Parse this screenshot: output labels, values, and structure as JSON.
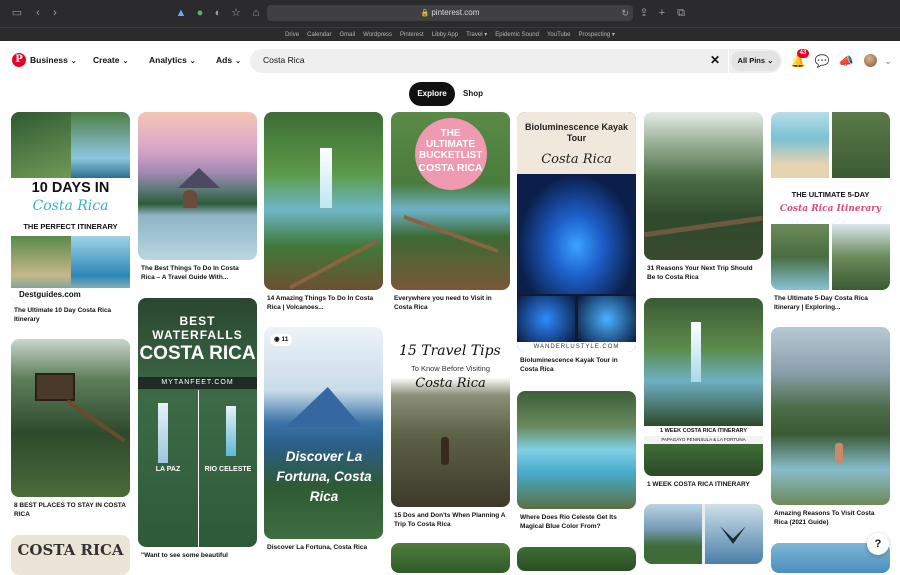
{
  "browser": {
    "url": "pinterest.com",
    "bookmarks": [
      "Drive",
      "Calendar",
      "Gmail",
      "Wordpress",
      "Pinterest",
      "Libby App",
      "Travel ▾",
      "Epidemic Sound",
      "YouTube",
      "Prospecting ▾"
    ]
  },
  "header": {
    "logo": "P",
    "nav": [
      "Business",
      "Create",
      "Analytics",
      "Ads"
    ],
    "search_value": "Costa Rica",
    "filter_label": "All Pins",
    "notif_count": "43"
  },
  "tabs": {
    "explore": "Explore",
    "shop": "Shop"
  },
  "pins": [
    {
      "title": "The Ultimate 10 Day Costa Rica Itinerary",
      "img": [
        "10 DAYS IN",
        "Costa Rica",
        "THE PERFECT ITINERARY",
        "Destguides.com"
      ]
    },
    {
      "title": "The Best Things To Do In Costa Rica – A Travel Guide With..."
    },
    {
      "title": "14 Amazing Things To Do In Costa Rica | Volcanoes..."
    },
    {
      "title": "Everywhere you need to Visit in Costa Rica",
      "img": [
        "THE ULTIMATE BUCKETLIST",
        "COSTA RICA"
      ]
    },
    {
      "title": "Bioluminescence Kayak Tour in Costa Rica",
      "img": [
        "Bioluminescence Kayak Tour",
        "Costa Rica",
        "WANDERLUSTYLE.COM"
      ]
    },
    {
      "title": "31 Reasons Your Next Trip Should Be to Costa Rica"
    },
    {
      "title": "The Ultimate 5-Day Costa Rica Itinerary | Exploring...",
      "img": [
        "THE ULTIMATE 5-DAY",
        "Costa Rica Itinerary"
      ]
    },
    {
      "title": "8 BEST PLACES TO STAY IN COSTA RICA"
    },
    {
      "title": "\"Want to see some beautiful",
      "img": [
        "BEST",
        "WATERFALLS",
        "COSTA RICA",
        "MYTANFEET.COM",
        "LA PAZ",
        "RIO CELESTE"
      ]
    },
    {
      "title": "Discover La Fortuna, Costa Rica",
      "img": [
        "Discover La Fortuna, Costa Rica",
        "11"
      ]
    },
    {
      "title": "15 Dos and Don'ts When Planning A Trip To Costa Rica",
      "img": [
        "15 Travel Tips",
        "To Know Before Visiting",
        "Costa Rica"
      ]
    },
    {
      "title": "Where Does Rio Celeste Get Its Magical Blue Color From?"
    },
    {
      "title": "1 WEEK COSTA RICA ITINERARY",
      "img": [
        "1 WEEK COSTA RICA ITINERARY",
        "PAPAGAYO PENINSULA & LA FORTUNA"
      ]
    },
    {
      "title": "Amazing Reasons To Visit Costa Rica (2021 Guide)"
    },
    {
      "title": "",
      "img": [
        "COSTA RICA"
      ]
    }
  ],
  "help": "?"
}
